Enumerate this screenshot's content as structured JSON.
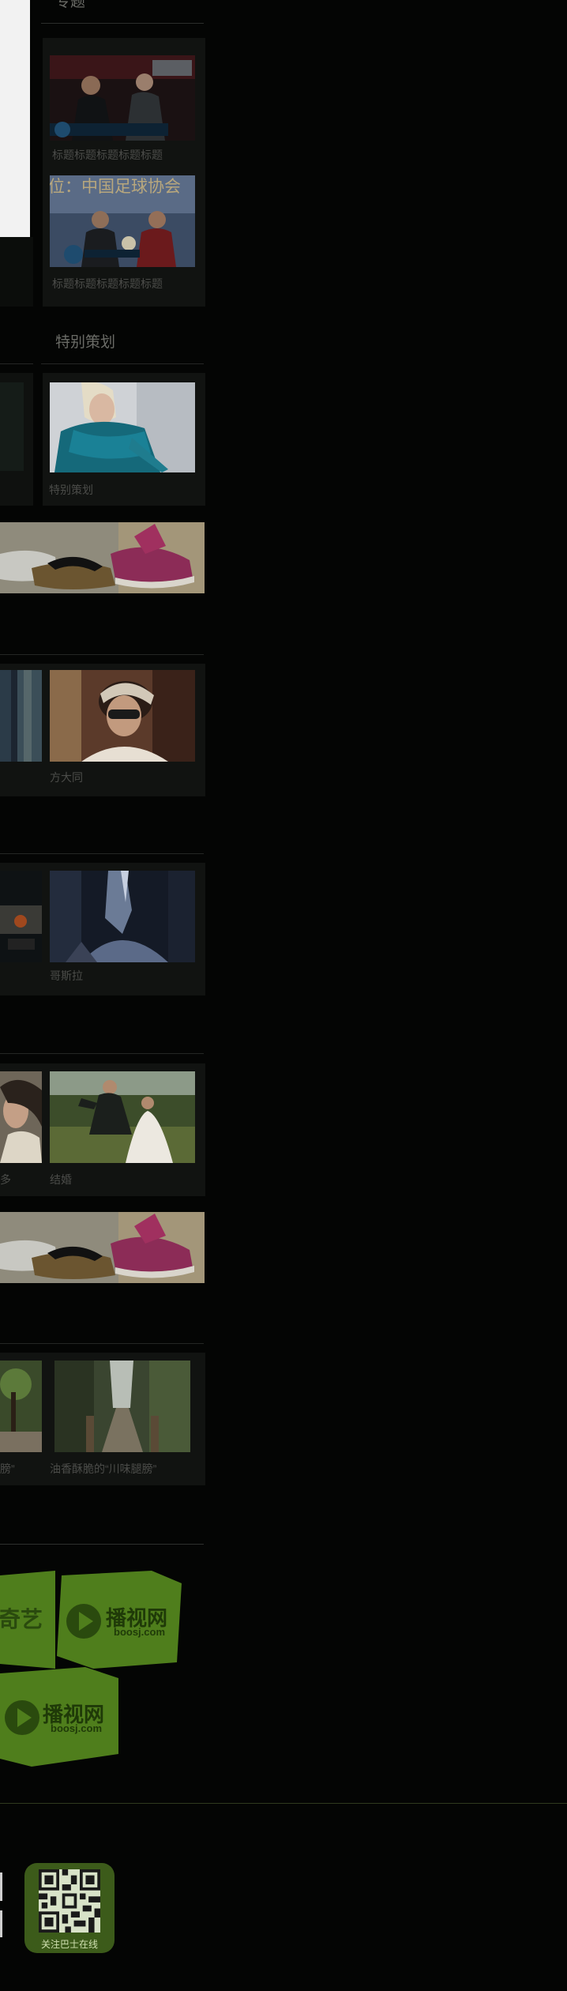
{
  "sections": {
    "zhuanti": {
      "title": "专题",
      "items": [
        {
          "caption": "标题标题标题标题标题"
        },
        {
          "caption": "标题标题标题标题标题"
        }
      ]
    },
    "tebie": {
      "title": "特别策划",
      "items": [
        {
          "caption": "特别策划"
        }
      ]
    },
    "row_fangdatong": {
      "items": [
        {
          "caption": "方大同"
        }
      ]
    },
    "row_gesila": {
      "items": [
        {
          "caption": "哥斯拉"
        }
      ]
    },
    "row_jiehun": {
      "items": [
        {
          "caption": "多"
        },
        {
          "caption": "结婚"
        }
      ]
    },
    "row_youxiang": {
      "items": [
        {
          "caption": "膀”"
        },
        {
          "caption": "油香酥脆的“川味腿膀”"
        }
      ]
    }
  },
  "image_texts": {
    "jersey_banner": "位：中国足球协会",
    "ad_logo": "播视网",
    "ad_logo_url": "boosj.com",
    "ad_logo_partner": "爱奇艺"
  },
  "footer": {
    "qr_caption": "关注巴士在线"
  },
  "colors": {
    "background": "#040504",
    "panel": "#111311",
    "logo_green": "#4f7e1c",
    "qr_green": "#3c5b1a"
  }
}
